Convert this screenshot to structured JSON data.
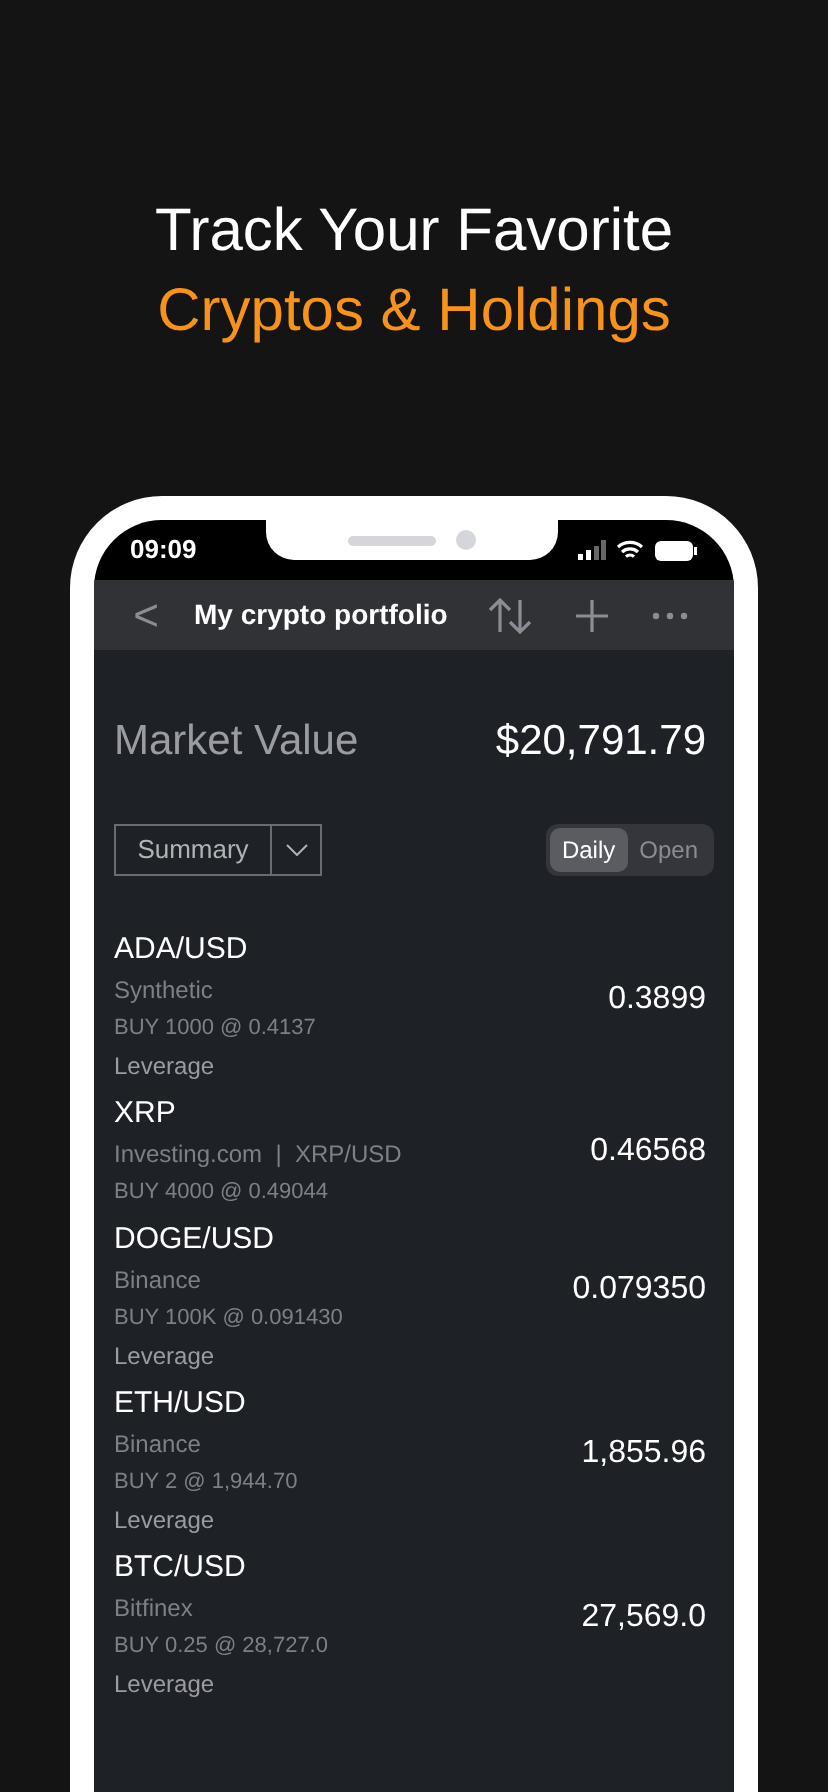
{
  "headline": {
    "line_1": "Track Your Favorite",
    "line_2": "Cryptos & Holdings"
  },
  "status_bar": {
    "time": "09:09"
  },
  "nav_bar": {
    "back": "<",
    "title": "My crypto portfolio"
  },
  "market_value": {
    "label": "Market Value",
    "value": "$20,791.79"
  },
  "view_select": {
    "value": "Summary"
  },
  "period_tabs": [
    {
      "label": "Daily",
      "selected": true
    },
    {
      "label": "Open",
      "selected": false
    }
  ],
  "holdings": [
    {
      "symbol": "ADA/USD",
      "source": "Synthetic",
      "trade": "BUY 1000 @ 0.4137",
      "leverage": "Leverage",
      "price": "0.3899"
    },
    {
      "symbol": "XRP",
      "source": "Investing.com  |  XRP/USD",
      "trade": "BUY 4000 @ 0.49044",
      "price": "0.46568"
    },
    {
      "symbol": "DOGE/USD",
      "source": "Binance",
      "trade": "BUY 100K @ 0.091430",
      "leverage": "Leverage",
      "price": "0.079350"
    },
    {
      "symbol": "ETH/USD",
      "source": "Binance",
      "trade": "BUY 2 @ 1,944.70",
      "leverage": "Leverage",
      "price": "1,855.96"
    },
    {
      "symbol": "BTC/USD",
      "source": "Bitfinex",
      "trade": "BUY 0.25 @ 28,727.0",
      "leverage": "Leverage",
      "price": "27,569.0"
    }
  ]
}
